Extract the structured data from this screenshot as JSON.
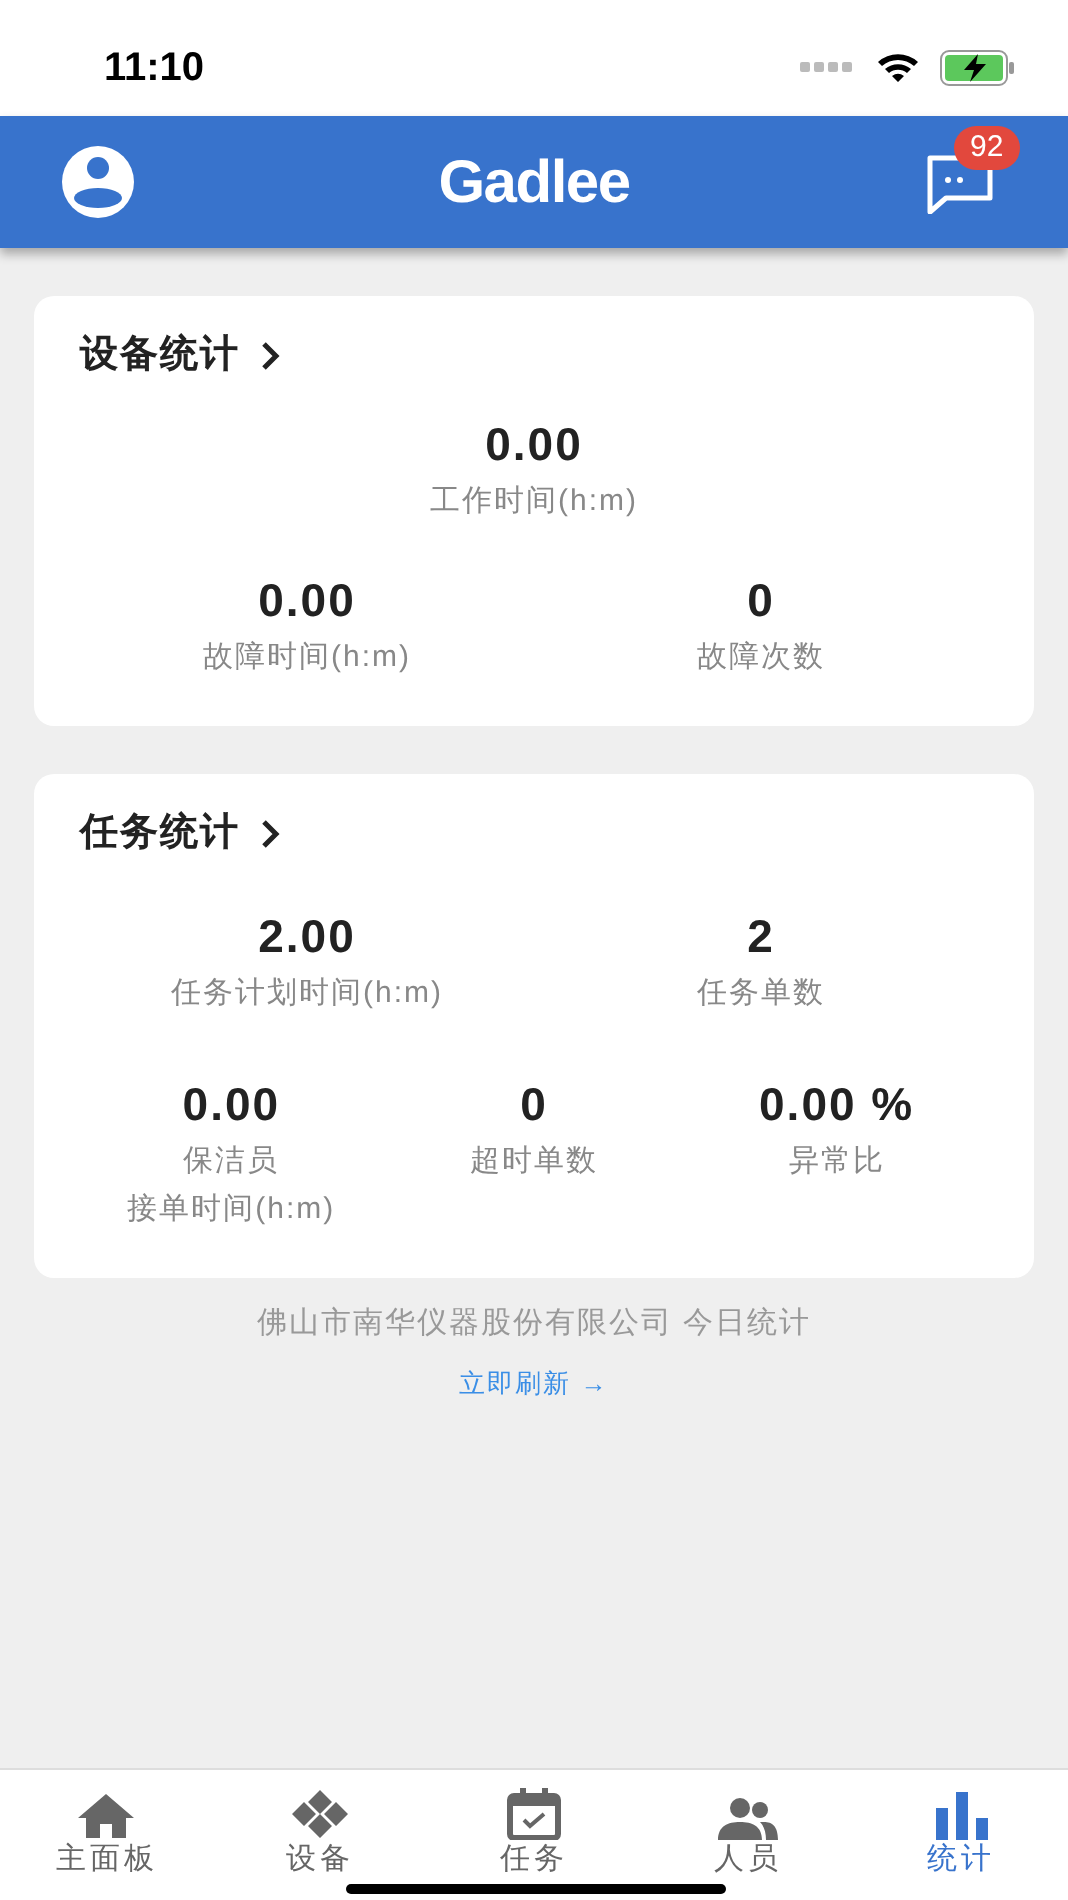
{
  "status_bar": {
    "time": "11:10"
  },
  "header": {
    "logo": "Gadlee",
    "badge": "92"
  },
  "cards": [
    {
      "title": "设备统计",
      "rows": [
        [
          {
            "value": "0.00",
            "label_lines": [
              "工作时间(h:m)"
            ]
          }
        ],
        [
          {
            "value": "0.00",
            "label_lines": [
              "故障时间(h:m)"
            ]
          },
          {
            "value": "0",
            "label_lines": [
              "故障次数"
            ]
          }
        ]
      ]
    },
    {
      "title": "任务统计",
      "rows": [
        [
          {
            "value": "2.00",
            "label_lines": [
              "任务计划时间(h:m)"
            ]
          },
          {
            "value": "2",
            "label_lines": [
              "任务单数"
            ]
          }
        ],
        [
          {
            "value": "0.00",
            "label_lines": [
              "保洁员",
              "接单时间(h:m)"
            ]
          },
          {
            "value": "0",
            "label_lines": [
              "超时单数"
            ]
          },
          {
            "value": "0.00 %",
            "label_lines": [
              "异常比"
            ]
          }
        ]
      ]
    }
  ],
  "footer": {
    "note": "佛山市南华仪器股份有限公司 今日统计",
    "link": "立即刷新 →"
  },
  "tabs": [
    {
      "kind": "home",
      "label": "主面板",
      "selected": false
    },
    {
      "kind": "device",
      "label": "设备",
      "selected": false
    },
    {
      "kind": "task",
      "label": "任务",
      "selected": false
    },
    {
      "kind": "people",
      "label": "人员",
      "selected": false
    },
    {
      "kind": "stats",
      "label": "统计",
      "selected": true
    }
  ]
}
